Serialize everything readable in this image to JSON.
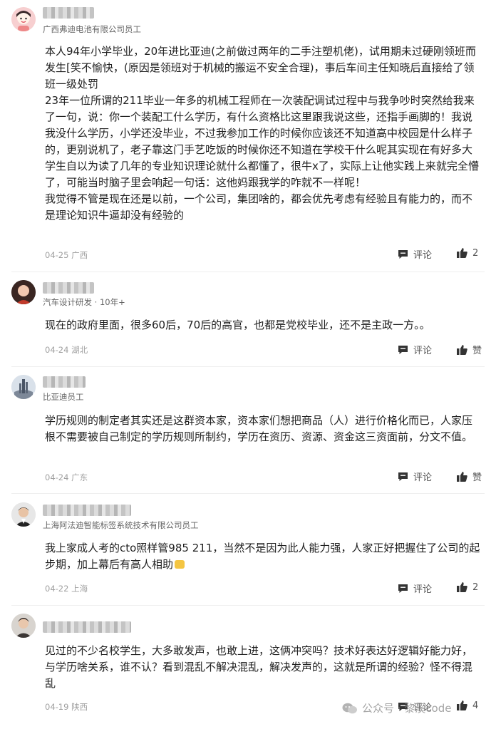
{
  "comments": [
    {
      "company": "广西弗迪电池有限公司员工",
      "body": "本人94年小学毕业，20年进比亚迪(之前做过两年的二手注塑机佬)，试用期未过硬刚领班而发生[笑不愉快，(原因是领班对于机械的搬运不安全合理)，事后车间主任知晓后直接给了领班一级处罚\n23年一位所谓的211毕业一年多的机械工程师在一次装配调试过程中与我争吵时突然给我来了一句，说：你一个装配工什么学历，有什么资格比这里跟我说这些，还指手画脚的！我说我没什么学历，小学还没毕业，不过我参加工作的时候你应该还不知道高中校园是什么样子的，更别说机了，老子靠这门手艺吃饭的时候你还不知道在学校干什么呢其实现在有好多大学生自以为读了几年的专业知识理论就什么都懂了，很牛x了，实际上让他实践上来就完全懵了，可能当时脑子里会响起一句话：这他妈跟我学的咋就不一样呢！\n我觉得不管是现在还是以前，一个公司，集团啥的，都会优先考虑有经验且有能力的，而不是理论知识牛逼却没有经验的",
      "date": "04-25 广西",
      "comment_label": "评论",
      "like_label": "2"
    },
    {
      "company": "汽车设计研发 · 10年+",
      "body": "现在的政府里面，很多60后，70后的高官，也都是党校毕业，还不是主政一方。。",
      "date": "04-24 湖北",
      "comment_label": "评论",
      "like_label": "赞"
    },
    {
      "company": "比亚迪员工",
      "body": "学历规则的制定者其实还是这群资本家，资本家们想把商品（人）进行价格化而已，人家压根不需要被自己制定的学历规则所制约，学历在资历、资源、资金这三资面前，分文不值。",
      "date": "04-24 广东",
      "comment_label": "评论",
      "like_label": "赞"
    },
    {
      "company": "上海阿法迪智能标签系统技术有限公司员工",
      "body": "我上家成人考的cto照样管985 211，当然不是因为此人能力强，人家正好把握住了公司的起步期，加上幕后有高人相助",
      "date": "04-22 上海",
      "comment_label": "评论",
      "like_label": "2"
    },
    {
      "company": "",
      "body": "见过的不少名校学生，大多敢发声，也敢上进，这俩冲突吗？技术好表达好逻辑好能力好，与学历啥关系，谁不认？看到混乱不解决混乱，解决发声的，这就是所谓的经验？怪不得混乱",
      "date": "04-19 陕西",
      "comment_label": "评论",
      "like_label": "4"
    }
  ],
  "watermark": "公众号 · 黎溪code"
}
